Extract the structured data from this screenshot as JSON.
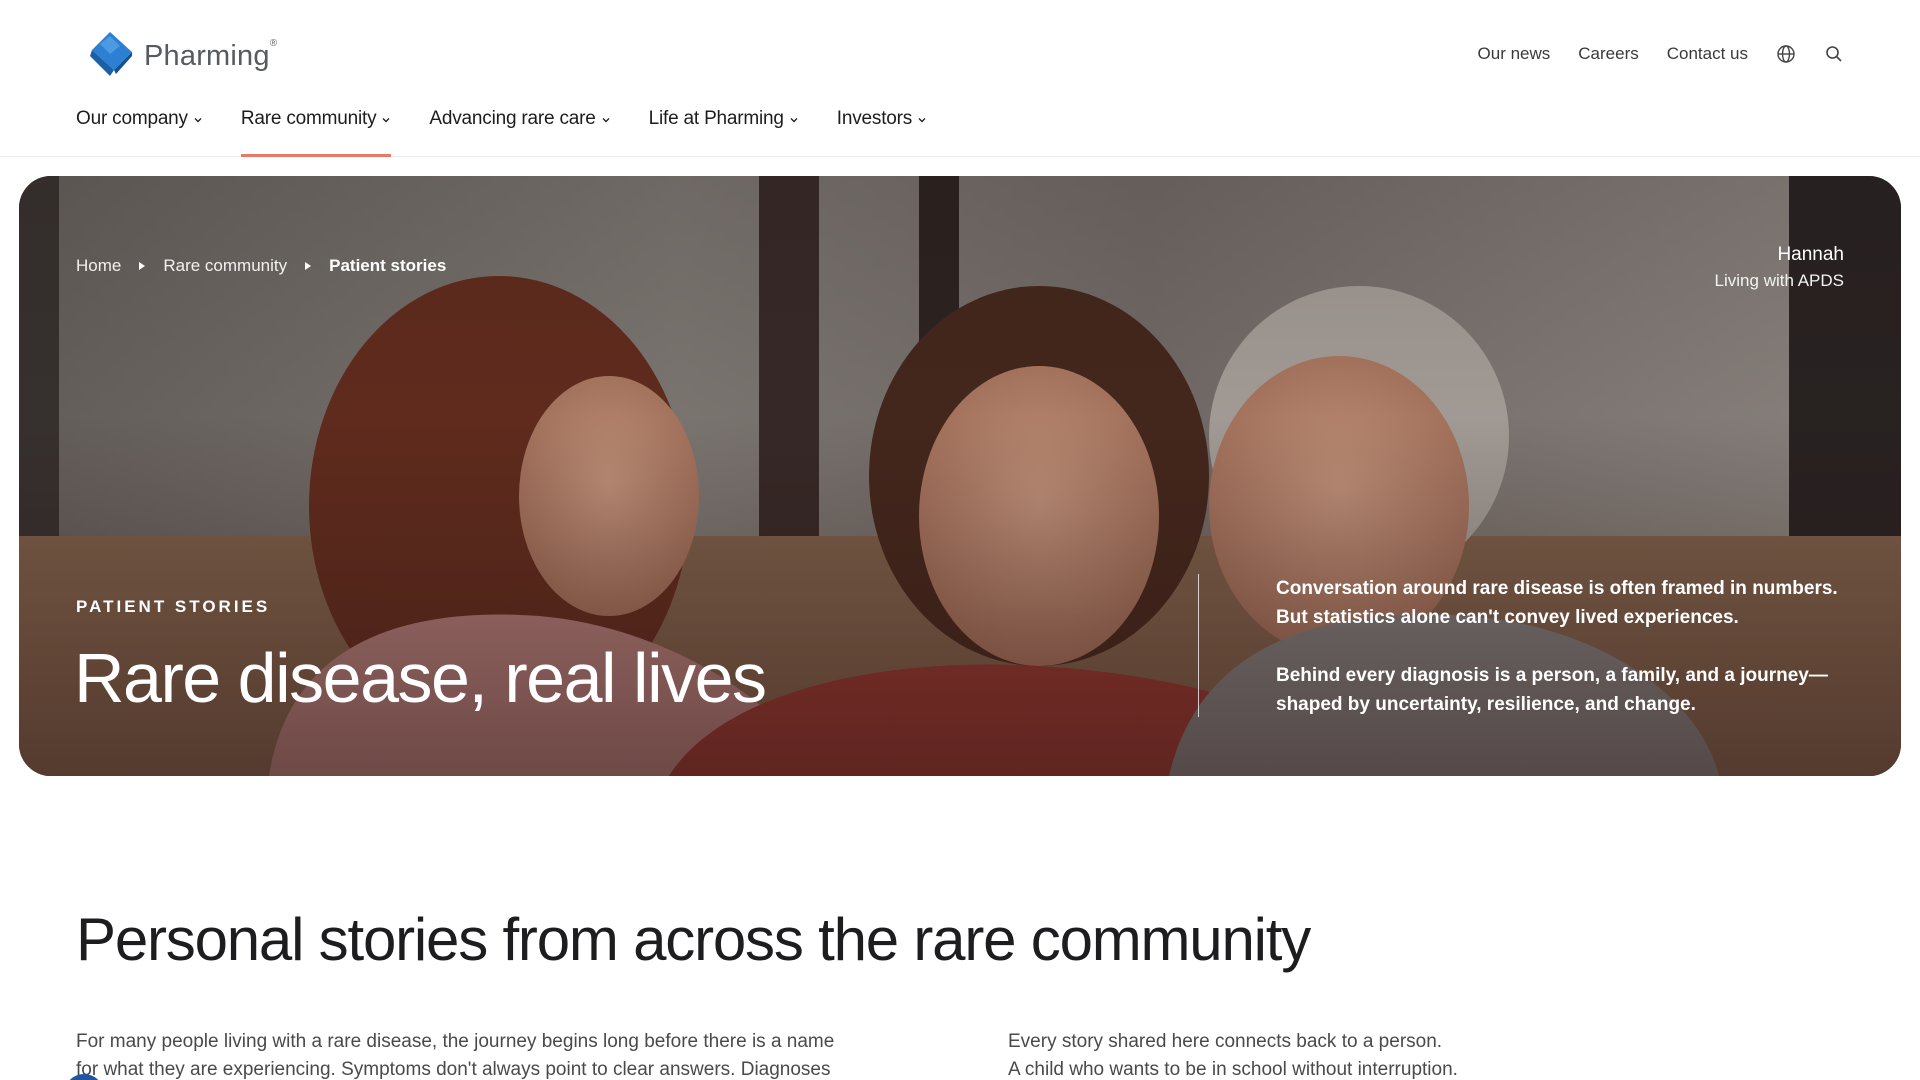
{
  "brand": {
    "name": "Pharming",
    "reg": "®",
    "colors": {
      "primary": "#1e6bb8",
      "accent": "#e8786a"
    }
  },
  "utility_nav": {
    "items": [
      "Our news",
      "Careers",
      "Contact us"
    ],
    "icons": [
      "globe-icon",
      "search-icon"
    ]
  },
  "main_nav": {
    "items": [
      {
        "label": "Our company",
        "active": false
      },
      {
        "label": "Rare community",
        "active": true
      },
      {
        "label": "Advancing rare care",
        "active": false
      },
      {
        "label": "Life at Pharming",
        "active": false
      },
      {
        "label": "Investors",
        "active": false
      }
    ]
  },
  "hero": {
    "breadcrumb": [
      "Home",
      "Rare community",
      "Patient stories"
    ],
    "caption_name": "Hannah",
    "caption_sub": "Living with APDS",
    "eyebrow": "PATIENT STORIES",
    "title": "Rare disease, real lives",
    "paragraph_1_line_1": "Conversation around rare disease is often framed in numbers.",
    "paragraph_1_line_2": "But statistics alone can't convey lived experiences.",
    "paragraph_2_line_1": "Behind every diagnosis is a person, a family, and a journey—",
    "paragraph_2_line_2": "shaped by uncertainty, resilience, and change."
  },
  "section": {
    "title": "Personal stories from across the rare community",
    "left_line_1": "For many people living with a rare disease, the journey begins long before there is a name",
    "left_line_2": "for what they are experiencing. Symptoms don't always point to clear answers. Diagnoses",
    "right_line_1": "Every story shared here connects back to a person.",
    "right_line_2": "A child who wants to be in school without interruption."
  }
}
